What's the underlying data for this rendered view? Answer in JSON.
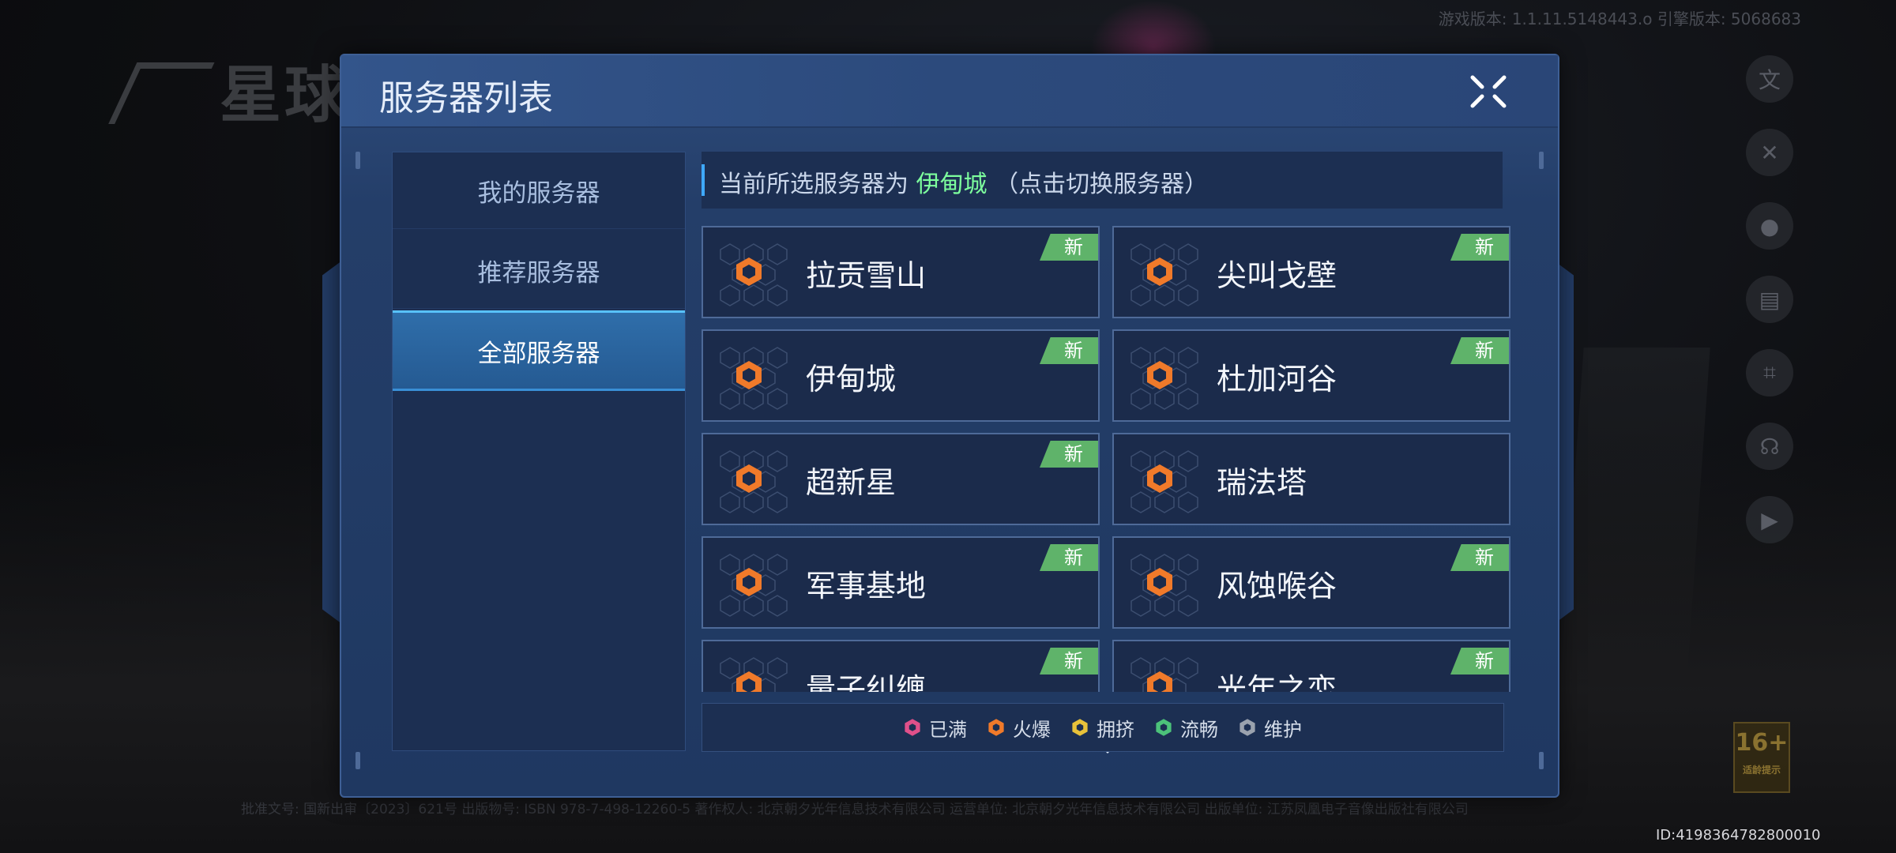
{
  "hud": {
    "version_text": "游戏版本: 1.1.11.5148443.o  引擎版本: 5068683",
    "uid_text": "ID:4198364782800010",
    "legal_text": "批准文号: 国新出审〔2023〕621号  出版物号: ISBN 978-7-498-12260-5  著作权人: 北京朝夕光年信息技术有限公司  运营单位: 北京朝夕光年信息技术有限公司  出版单位: 江苏凤凰电子音像出版社有限公司",
    "age_rating": "16+",
    "age_caption": "适龄提示",
    "logo_text": "星球",
    "side_icons": [
      "translate-icon",
      "tools-icon",
      "profile-icon",
      "notice-icon",
      "scan-icon",
      "support-icon",
      "video-icon"
    ]
  },
  "dialog": {
    "title": "服务器列表",
    "tabs": [
      {
        "label": "我的服务器",
        "active": false
      },
      {
        "label": "推荐服务器",
        "active": false
      },
      {
        "label": "全部服务器",
        "active": true
      }
    ],
    "current": {
      "prefix": "当前所选服务器为 ",
      "name": "伊甸城",
      "suffix": " （点击切换服务器）"
    },
    "servers": [
      {
        "name": "拉贡雪山",
        "badge": "新",
        "status": "hot"
      },
      {
        "name": "尖叫戈壁",
        "badge": "新",
        "status": "hot"
      },
      {
        "name": "伊甸城",
        "badge": "新",
        "status": "hot"
      },
      {
        "name": "杜加河谷",
        "badge": "新",
        "status": "hot"
      },
      {
        "name": "超新星",
        "badge": "新",
        "status": "hot"
      },
      {
        "name": "瑞法塔",
        "badge": "",
        "status": "hot"
      },
      {
        "name": "军事基地",
        "badge": "新",
        "status": "hot"
      },
      {
        "name": "风蚀喉谷",
        "badge": "新",
        "status": "hot"
      },
      {
        "name": "量子纠缠",
        "badge": "新",
        "status": "hot"
      },
      {
        "name": "光年之恋",
        "badge": "新",
        "status": "hot"
      }
    ],
    "legend": [
      {
        "label": "已满",
        "color": "#e0508a"
      },
      {
        "label": "火爆",
        "color": "#f07a2a"
      },
      {
        "label": "拥挤",
        "color": "#e8c23a"
      },
      {
        "label": "流畅",
        "color": "#4cc27a"
      },
      {
        "label": "维护",
        "color": "#9aa2ae"
      }
    ],
    "colors": {
      "hot": "#f07a2a",
      "new_badge": "#5fb36a",
      "selected_name": "#7dff9d"
    }
  }
}
